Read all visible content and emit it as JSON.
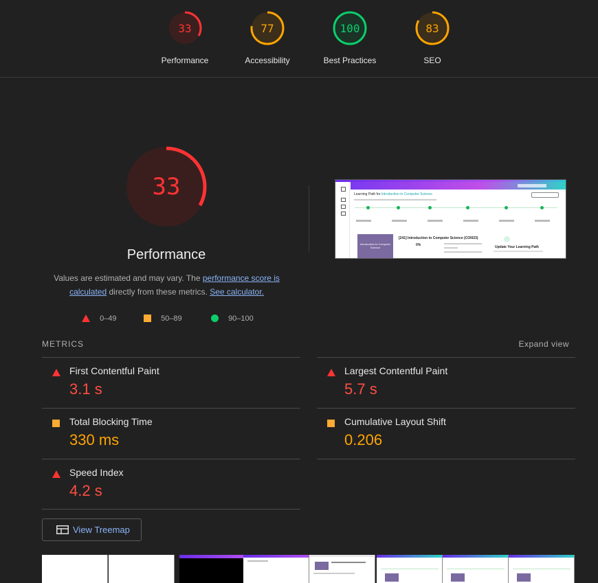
{
  "categories": [
    {
      "label": "Performance",
      "score": "33",
      "color": "#ff3333",
      "fraction": 0.33
    },
    {
      "label": "Accessibility",
      "score": "77",
      "color": "#ffa400",
      "fraction": 0.77
    },
    {
      "label": "Best Practices",
      "score": "100",
      "color": "#0cce6b",
      "fraction": 1.0
    },
    {
      "label": "SEO",
      "score": "83",
      "color": "#ffa400",
      "fraction": 0.83
    }
  ],
  "performance": {
    "score": "33",
    "fraction": 0.33,
    "title": "Performance",
    "desc_part1": "Values are estimated and may vary. The ",
    "desc_link1": "performance score is calculated",
    "desc_part2": " directly from these metrics. ",
    "desc_link2": "See calculator."
  },
  "legend": [
    {
      "symbol": "triangle",
      "range": "0–49"
    },
    {
      "symbol": "square",
      "range": "50–89"
    },
    {
      "symbol": "circle",
      "range": "90–100"
    }
  ],
  "metrics_label": "METRICS",
  "expand_label": "Expand view",
  "metrics": [
    {
      "title": "First Contentful Paint",
      "value": "3.1 s",
      "status": "fail"
    },
    {
      "title": "Largest Contentful Paint",
      "value": "5.7 s",
      "status": "fail"
    },
    {
      "title": "Total Blocking Time",
      "value": "330 ms",
      "status": "average"
    },
    {
      "title": "Cumulative Layout Shift",
      "value": "0.206",
      "status": "average"
    },
    {
      "title": "Speed Index",
      "value": "4.2 s",
      "status": "fail"
    }
  ],
  "treemap_label": "View Treemap",
  "screenshot": {
    "heading_prefix": "Learning Path for ",
    "heading_course": "Introduction to Computer Science",
    "card_title": "Introduction to Computer Science",
    "course_heading": "[241] Introduction to Computer Science (COI023)",
    "percent": "0%",
    "update_heading": "Update Your Learning Path"
  },
  "colors": {
    "fail": "#ff4e42",
    "average": "#ffa400",
    "pass": "#0cce6b",
    "link": "#8ab4f8"
  }
}
